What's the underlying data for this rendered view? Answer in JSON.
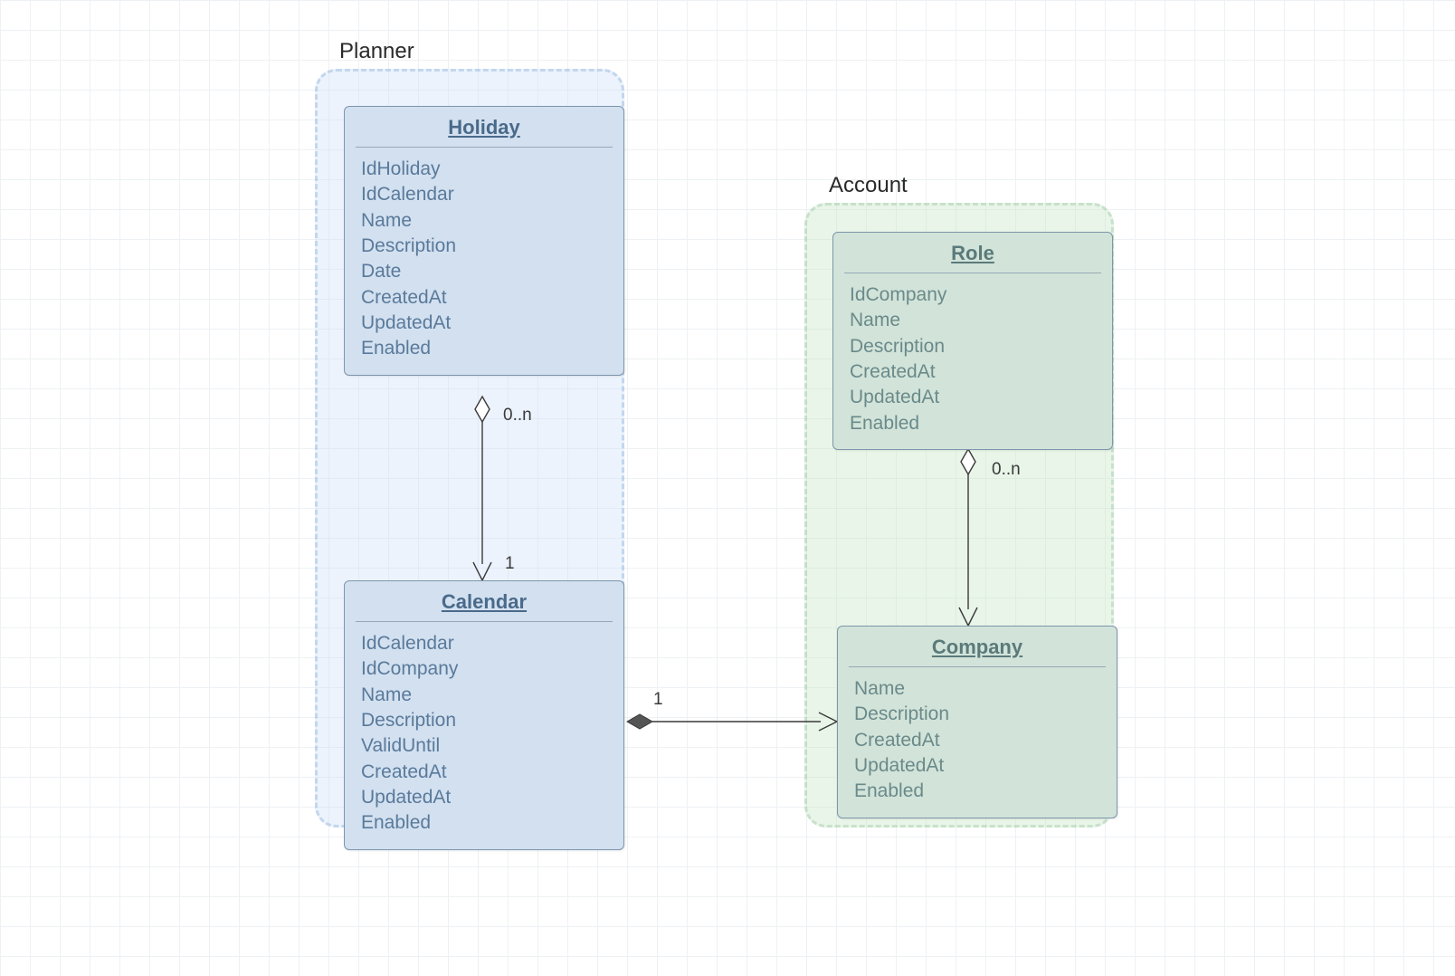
{
  "packages": {
    "planner": {
      "label": "Planner"
    },
    "account": {
      "label": "Account"
    }
  },
  "classes": {
    "holiday": {
      "title": "Holiday",
      "attrs": [
        "IdHoliday",
        "IdCalendar",
        "Name",
        "Description",
        "Date",
        "CreatedAt",
        "UpdatedAt",
        "Enabled"
      ]
    },
    "calendar": {
      "title": "Calendar",
      "attrs": [
        "IdCalendar",
        "IdCompany",
        "Name",
        "Description",
        "ValidUntil",
        "CreatedAt",
        "UpdatedAt",
        "Enabled"
      ]
    },
    "role": {
      "title": "Role",
      "attrs": [
        "IdCompany",
        "Name",
        "Description",
        "CreatedAt",
        "UpdatedAt",
        "Enabled"
      ]
    },
    "company": {
      "title": "Company",
      "attrs": [
        "Name",
        "Description",
        "CreatedAt",
        "UpdatedAt",
        "Enabled"
      ]
    }
  },
  "relations": {
    "holiday_calendar": {
      "source_mult": "0..n",
      "target_mult": "1",
      "type": "aggregation"
    },
    "role_company": {
      "source_mult": "0..n",
      "target_mult": "",
      "type": "aggregation"
    },
    "calendar_company": {
      "source_mult": "1",
      "target_mult": "",
      "type": "composition"
    }
  }
}
